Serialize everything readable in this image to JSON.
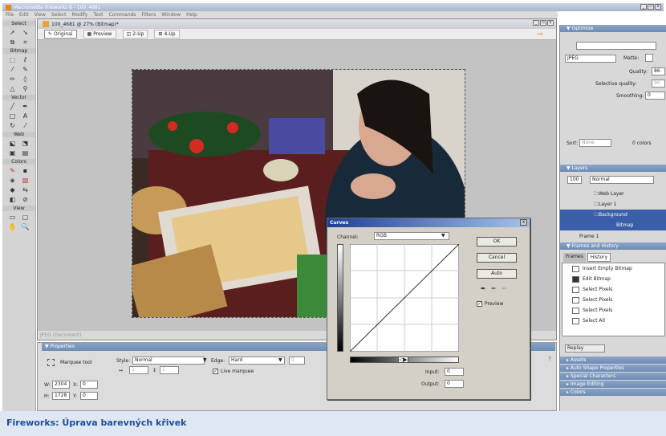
{
  "window": {
    "title": "Macromedia Fireworks 8 - 100_4681"
  },
  "menu": [
    "File",
    "Edit",
    "View",
    "Select",
    "Modify",
    "Text",
    "Commands",
    "Filters",
    "Window",
    "Help"
  ],
  "tools": {
    "sections": [
      "Select",
      "Bitmap",
      "Vector",
      "Web",
      "Colors",
      "View"
    ]
  },
  "document": {
    "title": "100_4681 @ 27% (Bitmap)*",
    "tabs": [
      "Original",
      "Preview",
      "2-Up",
      "4-Up"
    ],
    "status": "JPEG (Document)"
  },
  "properties": {
    "header": "Properties",
    "tool": "Marquee tool",
    "style_label": "Style:",
    "style_value": "Normal",
    "edge_label": "Edge:",
    "edge_value": "Hard",
    "edge_amount": "0",
    "live_marquee": "Live marquee",
    "w_label": "W:",
    "w_value": "2304",
    "h_label": "H:",
    "h_value": "1728",
    "x_label": "X:",
    "x_value": "0",
    "y_label": "Y:",
    "y_value": "0",
    "fixed_w": "1",
    "fixed_h": "1"
  },
  "optimize": {
    "header": "Optimize",
    "format": "JPEG",
    "matte_label": "Matte:",
    "quality_label": "Quality:",
    "quality_value": "86",
    "selective_label": "Selective quality:",
    "selective_value": "90",
    "smoothing_label": "Smoothing:",
    "smoothing_value": "0",
    "sort_label": "Sort:",
    "sort_value": "None",
    "colors_text": "0 colors"
  },
  "layers": {
    "header": "Layers",
    "opacity": "100",
    "blend": "Normal",
    "items": [
      "Web Layer",
      "Layer 1",
      "Background",
      "Bitmap"
    ],
    "frame": "Frame 1"
  },
  "frames_history": {
    "header": "Frames and History",
    "tabs": [
      "Frames",
      "History"
    ],
    "items": [
      "Insert Empty Bitmap",
      "Edit Bitmap",
      "Select Pixels",
      "Select Pixels",
      "Select Pixels",
      "Select All"
    ],
    "replay": "Replay"
  },
  "collapsed_panels": [
    "Assets",
    "Auto Shape Properties",
    "Special Characters",
    "Image Editing",
    "Colors"
  ],
  "curves": {
    "title": "Curves",
    "channel_label": "Channel:",
    "channel_value": "RGB",
    "ok": "OK",
    "cancel": "Cancel",
    "auto": "Auto",
    "preview": "Preview",
    "input_label": "Input:",
    "input_value": "0",
    "output_label": "Output:",
    "output_value": "0"
  },
  "caption": "Fireworks: Úprava barevných křivek"
}
